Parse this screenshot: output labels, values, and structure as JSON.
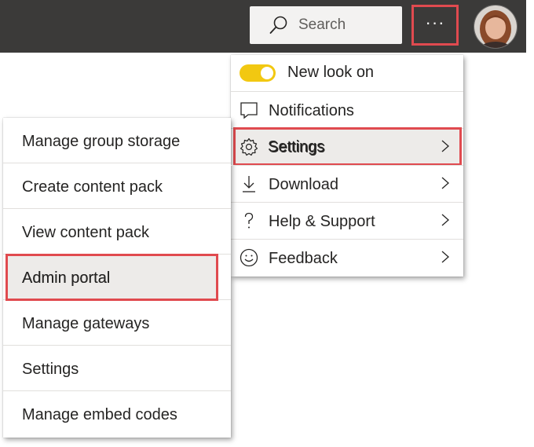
{
  "topbar": {
    "search_placeholder": "Search",
    "more_label": "···"
  },
  "main_menu": {
    "toggle_label": "New look on",
    "toggle_on": true,
    "items": [
      {
        "label": "Notifications",
        "icon": "notifications-icon",
        "has_submenu": false
      },
      {
        "label": "Settings",
        "icon": "gear-icon",
        "has_submenu": true
      },
      {
        "label": "Download",
        "icon": "download-icon",
        "has_submenu": true
      },
      {
        "label": "Help & Support",
        "icon": "question-icon",
        "has_submenu": true
      },
      {
        "label": "Feedback",
        "icon": "smiley-icon",
        "has_submenu": true
      }
    ]
  },
  "settings_submenu": {
    "items": [
      {
        "label": "Manage group storage"
      },
      {
        "label": "Create content pack"
      },
      {
        "label": "View content pack"
      },
      {
        "label": "Admin portal"
      },
      {
        "label": "Manage gateways"
      },
      {
        "label": "Settings"
      },
      {
        "label": "Manage embed codes"
      }
    ]
  },
  "colors": {
    "topbar": "#3b3a39",
    "toggle_on": "#f2c811",
    "highlight_border": "#e04a4f",
    "hover_background": "#edebe9"
  }
}
